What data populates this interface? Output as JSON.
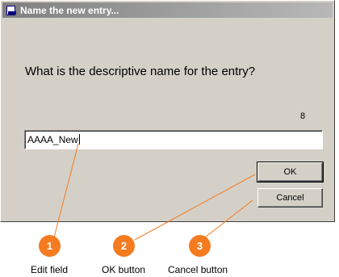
{
  "dialog": {
    "title": "Name the new entry...",
    "question": "What is the descriptive name for the entry?",
    "char_count": "8",
    "edit_value": "AAAA_New",
    "ok_label": "OK",
    "cancel_label": "Cancel"
  },
  "callouts": [
    {
      "number": "1",
      "label": "Edit field"
    },
    {
      "number": "2",
      "label": "OK button"
    },
    {
      "number": "3",
      "label": "Cancel button"
    }
  ],
  "colors": {
    "dialog_face": "#d4d0c8",
    "callout_accent": "#f47b20"
  }
}
